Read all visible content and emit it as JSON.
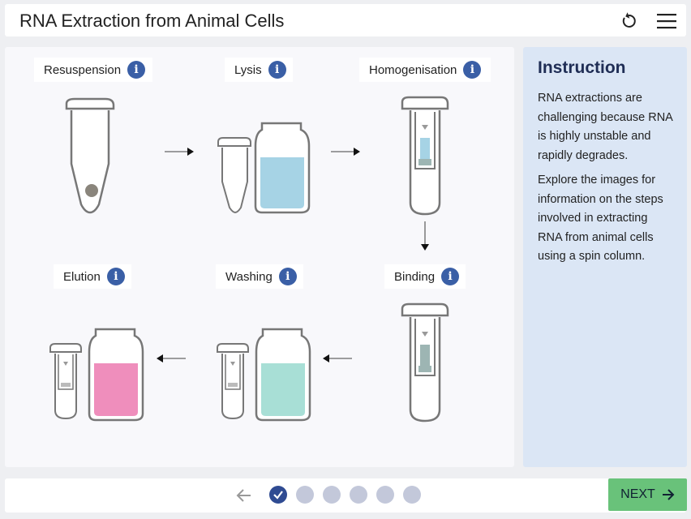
{
  "app": {
    "title": "RNA Extraction from Animal Cells"
  },
  "header": {
    "reset_icon": "reset-icon",
    "menu_icon": "hamburger-menu-icon"
  },
  "steps": [
    {
      "label": "Resuspension",
      "icon": "info-icon"
    },
    {
      "label": "Lysis",
      "icon": "info-icon"
    },
    {
      "label": "Homogenisation",
      "icon": "info-icon"
    },
    {
      "label": "Binding",
      "icon": "info-icon"
    },
    {
      "label": "Washing",
      "icon": "info-icon"
    },
    {
      "label": "Elution",
      "icon": "info-icon"
    }
  ],
  "info_glyph": "i",
  "instruction": {
    "heading": "Instruction",
    "paragraphs": [
      "RNA extractions are challenging because RNA is highly unstable and rapidly degrades.",
      "Explore the images for information on the steps involved in extracting RNA from animal cells using a spin column."
    ]
  },
  "colors": {
    "lysis_buffer": "#a6d3e5",
    "wash_buffer": "#a8dfd6",
    "elution_buffer": "#ef8ebc",
    "pellet": "#8a857c",
    "column_filter": "#9db5b3",
    "next_button": "#69c27a",
    "info_icon": "#3a5fa6",
    "panel_bg": "#dbe6f5"
  },
  "footer": {
    "back_icon": "arrow-left-icon",
    "pages_total": 6,
    "current_page": 1,
    "completed_pages": 1,
    "next_label": "NEXT",
    "next_icon": "arrow-right-icon"
  }
}
